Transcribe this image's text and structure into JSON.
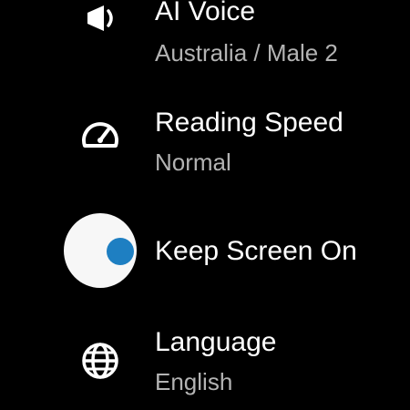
{
  "settings": {
    "voice": {
      "icon": "speaker-icon",
      "title": "AI Voice",
      "value": "Australia / Male 2"
    },
    "speed": {
      "icon": "speedometer-icon",
      "title": "Reading Speed",
      "value": "Normal"
    },
    "screen": {
      "icon": "toggle-switch",
      "title": "Keep Screen On",
      "enabled": true
    },
    "language": {
      "icon": "globe-icon",
      "title": "Language",
      "value": "English"
    }
  },
  "colors": {
    "background": "#000000",
    "title_text": "#ffffff",
    "subtitle_text": "#b3b3b3",
    "toggle_track": "#f7f7f7",
    "toggle_knob": "#1e7fc2"
  }
}
